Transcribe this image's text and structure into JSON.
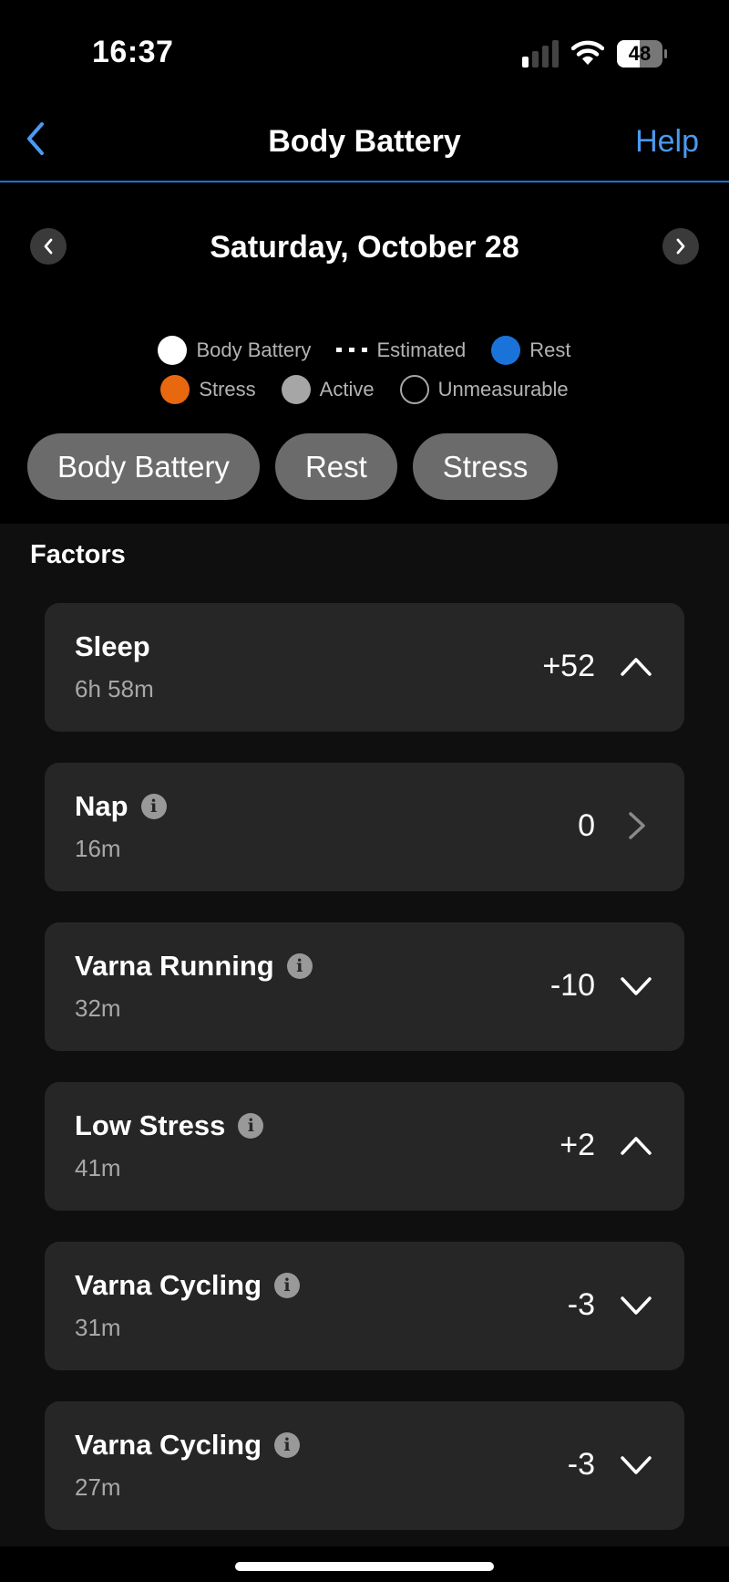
{
  "status_bar": {
    "time": "16:37",
    "battery_level": "48",
    "signal_bars_active": 1,
    "signal_bars_total": 4
  },
  "nav": {
    "back_icon": "chevron-left-icon",
    "title": "Body Battery",
    "help_label": "Help"
  },
  "date_nav": {
    "prev_icon": "chevron-left-icon",
    "date": "Saturday, October 28",
    "next_icon": "chevron-right-icon"
  },
  "legend": {
    "row1": [
      {
        "label": "Body Battery",
        "swatch": "filled",
        "color": "#ffffff"
      },
      {
        "label": "Estimated",
        "swatch": "dashed",
        "color": "#ffffff"
      },
      {
        "label": "Rest",
        "swatch": "filled",
        "color": "#1a73d9"
      }
    ],
    "row2": [
      {
        "label": "Stress",
        "swatch": "filled",
        "color": "#e8680f"
      },
      {
        "label": "Active",
        "swatch": "filled",
        "color": "#a6a6a6"
      },
      {
        "label": "Unmeasurable",
        "swatch": "outline",
        "color": "#a6a6a6"
      }
    ]
  },
  "chips": [
    "Body Battery",
    "Rest",
    "Stress"
  ],
  "factors": {
    "title": "Factors",
    "items": [
      {
        "name": "Sleep",
        "duration": "6h 58m",
        "value": "+52",
        "info": false,
        "chevron": "up"
      },
      {
        "name": "Nap",
        "duration": "16m",
        "value": "0",
        "info": true,
        "chevron": "right"
      },
      {
        "name": "Varna Running",
        "duration": "32m",
        "value": "-10",
        "info": true,
        "chevron": "down"
      },
      {
        "name": "Low Stress",
        "duration": "41m",
        "value": "+2",
        "info": true,
        "chevron": "up"
      },
      {
        "name": "Varna Cycling",
        "duration": "31m",
        "value": "-3",
        "info": true,
        "chevron": "down"
      },
      {
        "name": "Varna Cycling",
        "duration": "27m",
        "value": "-3",
        "info": true,
        "chevron": "down"
      }
    ]
  },
  "colors": {
    "accent": "#1a73d9",
    "link": "#4a9af0",
    "card_bg": "#262626",
    "chip_bg": "#6b6b6b"
  }
}
